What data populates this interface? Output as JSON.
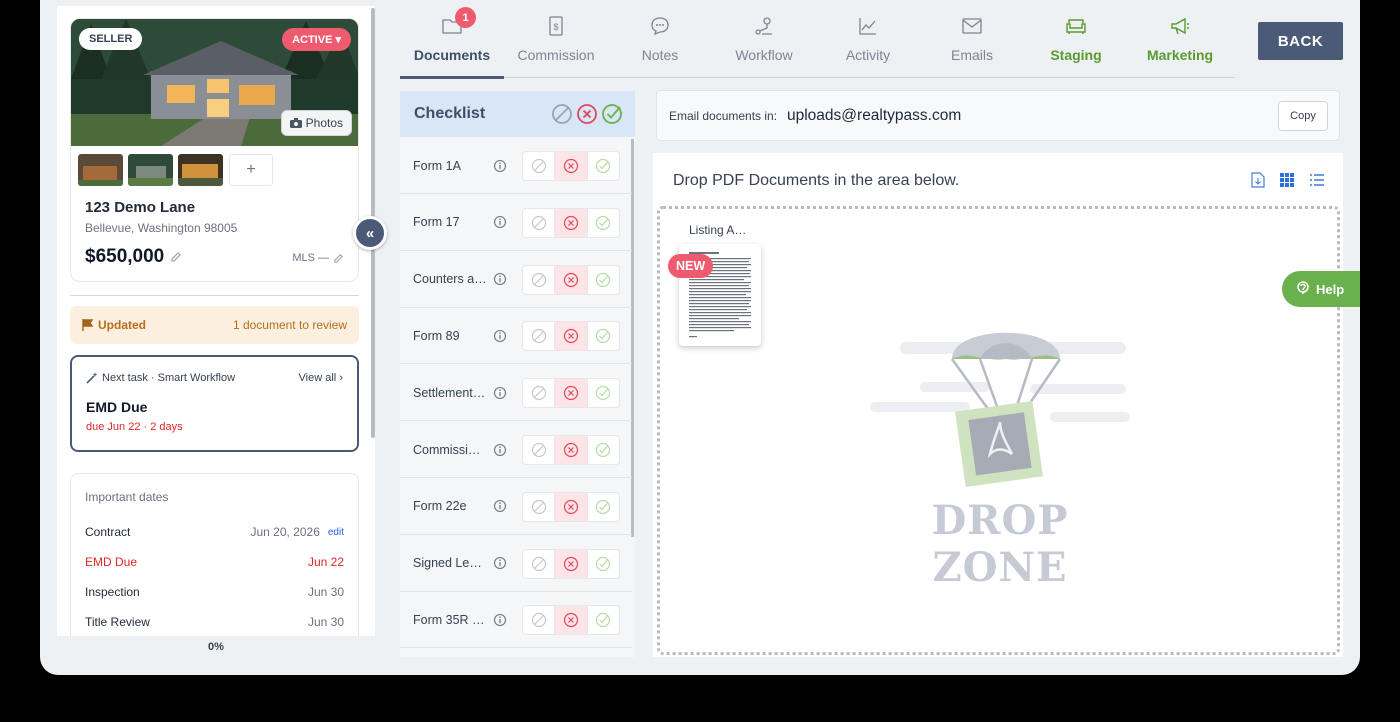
{
  "property": {
    "side_badge": "SELLER",
    "status_badge": "ACTIVE",
    "photos_label": "Photos",
    "add_photo": "+",
    "address": "123 Demo Lane",
    "city": "Bellevue, Washington 98005",
    "price": "$650,000",
    "mls": "MLS —"
  },
  "updated": {
    "label": "Updated",
    "detail": "1 document to review"
  },
  "next_task": {
    "header": "Next task · Smart Workflow",
    "view_all": "View all",
    "title": "EMD Due",
    "due": "due Jun 22 · 2 days"
  },
  "important_dates": {
    "heading": "Important dates",
    "rows": [
      {
        "label": "Contract",
        "value": "Jun 20, 2026",
        "action": "edit"
      },
      {
        "label": "EMD Due",
        "value": "Jun 22"
      },
      {
        "label": "Inspection",
        "value": "Jun 30"
      },
      {
        "label": "Title Review",
        "value": "Jun 30"
      }
    ]
  },
  "progress": "0%",
  "collapse_label": "«",
  "tabs": [
    {
      "label": "Documents",
      "icon": "folder-icon",
      "badge": "1"
    },
    {
      "label": "Commission",
      "icon": "dollar-doc-icon"
    },
    {
      "label": "Notes",
      "icon": "chat-icon"
    },
    {
      "label": "Workflow",
      "icon": "workflow-icon"
    },
    {
      "label": "Activity",
      "icon": "activity-icon"
    },
    {
      "label": "Emails",
      "icon": "mail-icon"
    },
    {
      "label": "Staging",
      "icon": "sofa-icon"
    },
    {
      "label": "Marketing",
      "icon": "megaphone-icon"
    }
  ],
  "back_label": "BACK",
  "checklist": {
    "title": "Checklist",
    "items": [
      {
        "name": "Form 1A"
      },
      {
        "name": "Form 17"
      },
      {
        "name": "Counters a…"
      },
      {
        "name": "Form 89"
      },
      {
        "name": "Settlement …"
      },
      {
        "name": "Commissio…"
      },
      {
        "name": "Form 22e"
      },
      {
        "name": "Signed Leg…"
      },
      {
        "name": "Form 35R (…"
      }
    ]
  },
  "email_docs": {
    "label": "Email documents in:",
    "address": "uploads@realtypass.com",
    "copy_label": "Copy"
  },
  "dropzone": {
    "title": "Drop PDF Documents in the area below.",
    "doc_label": "Listing A…",
    "new_badge": "NEW",
    "watermark": "DROP ZONE"
  },
  "help_label": "Help",
  "colors": {
    "accent": "#4b5b77",
    "green": "#5a9a2f",
    "red": "#ef5b6e"
  }
}
